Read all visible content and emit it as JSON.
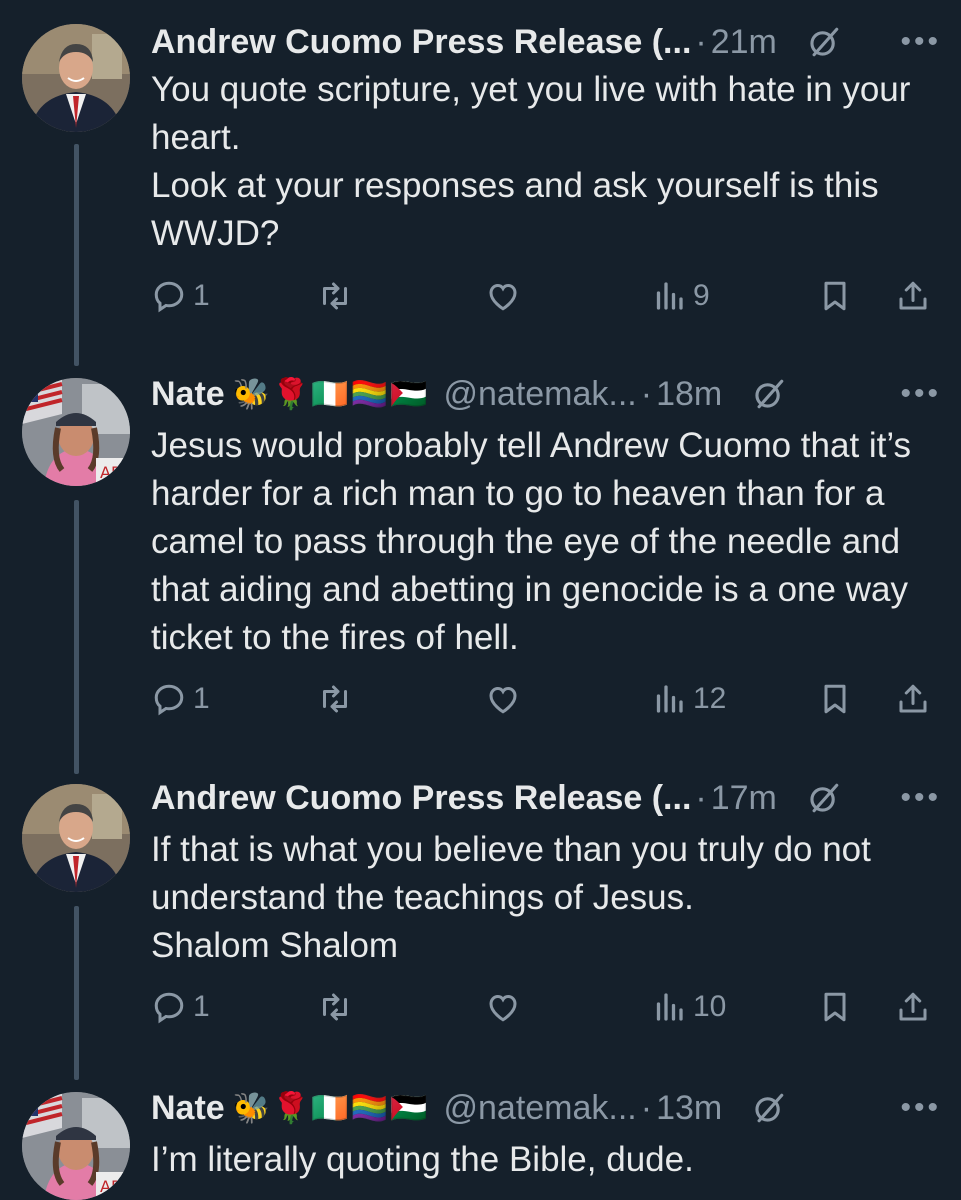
{
  "tweets": [
    {
      "name": "Andrew Cuomo Press Release (...",
      "emojis": "",
      "handle": "",
      "time": "21m",
      "text": [
        "You quote scripture, yet you live with hate in your heart.",
        "Look at your responses and ask yourself is this WWJD?"
      ],
      "replies": "1",
      "retweets": "",
      "likes": "",
      "views": "9",
      "avatar": "cuomo"
    },
    {
      "name": "Nate",
      "emojis": "🐝🌹🇮🇪🏳️‍🌈🇵🇸",
      "handle": "@natemak...",
      "time": "18m",
      "text": [
        "Jesus would probably tell Andrew Cuomo that it’s harder for a rich man to go to heaven than for a camel to pass through the eye of the needle and that aiding and abetting in genocide is a one way ticket to the fires of hell."
      ],
      "replies": "1",
      "retweets": "",
      "likes": "",
      "views": "12",
      "avatar": "nate"
    },
    {
      "name": "Andrew Cuomo Press Release (...",
      "emojis": "",
      "handle": "",
      "time": "17m",
      "text": [
        "If that is what you believe than you truly do not understand the teachings of Jesus.",
        "Shalom Shalom"
      ],
      "replies": "1",
      "retweets": "",
      "likes": "",
      "views": "10",
      "avatar": "cuomo"
    },
    {
      "name": "Nate",
      "emojis": "🐝🌹🇮🇪🏳️‍🌈🇵🇸",
      "handle": "@natemak...",
      "time": "13m",
      "text": [
        "I’m literally quoting the Bible, dude."
      ],
      "avatar": "nate"
    }
  ],
  "icons": {
    "reply": "reply-icon",
    "retweet": "retweet-icon",
    "like": "like-icon",
    "views": "views-icon",
    "bookmark": "bookmark-icon",
    "share": "share-icon",
    "grok": "grok-icon",
    "more": "more-icon"
  },
  "colors": {
    "background": "#15202b",
    "text": "#e7e9ea",
    "muted": "#8b98a5",
    "thread": "#425364"
  }
}
